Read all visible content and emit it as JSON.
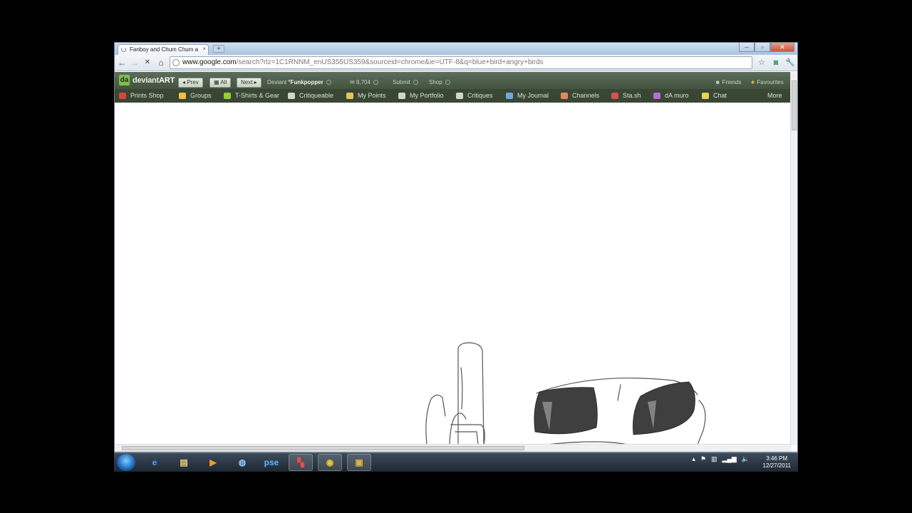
{
  "browser": {
    "tab_title": "Fanboy and Chum Chum a",
    "tab_close": "×",
    "new_tab": "+",
    "window_controls": {
      "minimize": "–",
      "maximize": "▫",
      "close": "✕"
    },
    "nav": {
      "back": "←",
      "forward": "→",
      "stop": "✕",
      "home": "⌂"
    },
    "url_host": "www.google.com",
    "url_rest": "/search?rlz=1C1RNNM_enUS355US359&sourceid=chrome&ie=UTF-8&q=blue+bird+angry+birds",
    "icons": [
      "star-icon",
      "extension-icon",
      "wrench-icon"
    ]
  },
  "deviantart": {
    "logo_mark": "da",
    "logo_text_1": "deviant",
    "logo_text_2": "ART",
    "prev": "◂ Prev",
    "all": "▦ All",
    "next": "Next ▸",
    "deviant_label": "Deviant",
    "username": "°Funkpopper",
    "message_count": "8,704",
    "submit": "Submit",
    "shop": "Shop",
    "friends": "Friends",
    "favourites": "Favourites",
    "menu": [
      {
        "label": "Prints Shop",
        "color": "#d7473b"
      },
      {
        "label": "Groups",
        "color": "#f0c040"
      },
      {
        "label": "T-Shirts & Gear",
        "color": "#9acd32"
      },
      {
        "label": "Critiqueable",
        "color": "#cfd8c8"
      },
      {
        "label": "My Points",
        "color": "#e6c35c"
      },
      {
        "label": "My Portfolio",
        "color": "#cfd8c8"
      },
      {
        "label": "Critiques",
        "color": "#cfd8c8"
      },
      {
        "label": "My Journal",
        "color": "#6fa8dc"
      },
      {
        "label": "Channels",
        "color": "#e08a5a"
      },
      {
        "label": "Sta.sh",
        "color": "#d94f4f"
      },
      {
        "label": "dA muro",
        "color": "#b36fd6"
      },
      {
        "label": "Chat",
        "color": "#e8d44d"
      }
    ],
    "more": "More"
  },
  "taskbar": {
    "apps": [
      {
        "name": "ie-icon",
        "glyph": "e",
        "color": "#4aa3ff"
      },
      {
        "name": "explorer-icon",
        "glyph": "▤",
        "color": "#f4d27a"
      },
      {
        "name": "media-player-icon",
        "glyph": "▶",
        "color": "#ff9b2a"
      },
      {
        "name": "paint-icon",
        "glyph": "◍",
        "color": "#8fc7ff"
      },
      {
        "name": "photoshop-elements-icon",
        "glyph": "pse",
        "color": "#5cb6ff"
      },
      {
        "name": "color-app-icon",
        "glyph": "▚",
        "color": "#e84c4c"
      },
      {
        "name": "chrome-icon",
        "glyph": "◉",
        "color": "#e8c840"
      },
      {
        "name": "recorder-icon",
        "glyph": "▣",
        "color": "#d9b64a"
      }
    ],
    "tray_icons": [
      "▴",
      "⚑",
      "▥",
      "▂▄▆",
      "🔈"
    ],
    "time": "3:46 PM",
    "date": "12/27/2011"
  }
}
